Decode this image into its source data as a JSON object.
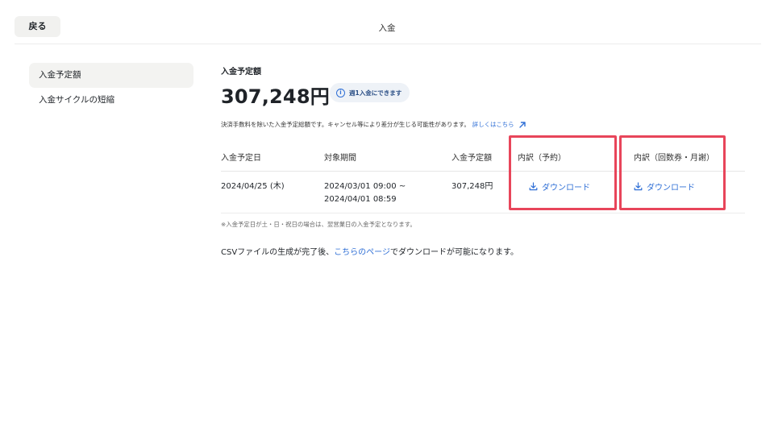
{
  "header": {
    "back_label": "戻る",
    "title": "入金"
  },
  "sidebar": {
    "items": [
      {
        "label": "入金予定額",
        "active": true
      },
      {
        "label": "入金サイクルの短縮",
        "active": false
      }
    ]
  },
  "main": {
    "section_label": "入金予定額",
    "amount": "307,248円",
    "cycle_badge": "週1入金にできます",
    "note": "決済手数料を除いた入金予定総額です。キャンセル等により差分が生じる可能性があります。",
    "note_link": "詳しくはこちら",
    "table": {
      "headers": [
        "入金予定日",
        "対象期間",
        "入金予定額",
        "内訳（予約）",
        "内訳（回数券・月謝）"
      ],
      "rows": [
        {
          "date": "2024/04/25 (木)",
          "period_start": "2024/03/01 09:00 ~",
          "period_end": "2024/04/01 08:59",
          "amount": "307,248円",
          "download_reservation": "ダウンロード",
          "download_tickets": "ダウンロード"
        }
      ]
    },
    "footnote": "※入金予定日が土・日・祝日の場合は、翌営業日の入金予定となります。",
    "csv_before": "CSVファイルの生成が完了後、",
    "csv_link": "こちらのページ",
    "csv_after": "でダウンロードが可能になります。"
  },
  "colors": {
    "accent": "#2f6fd6",
    "highlight": "#e8455a"
  },
  "icons": [
    "info-icon",
    "external-arrow-icon",
    "download-icon"
  ]
}
